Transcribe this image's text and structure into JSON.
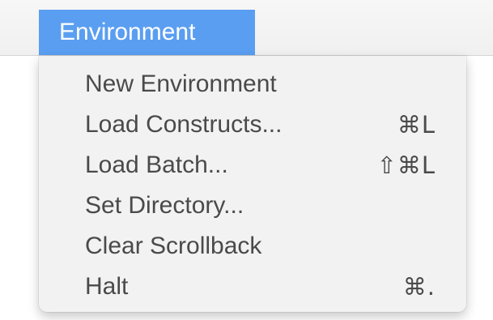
{
  "menubar": {
    "active_menu": "Environment"
  },
  "menu": {
    "items": [
      {
        "label": "New Environment",
        "shortcut": ""
      },
      {
        "label": "Load Constructs...",
        "shortcut": "⌘L"
      },
      {
        "label": "Load Batch...",
        "shortcut": "⇧⌘L"
      },
      {
        "label": "Set Directory...",
        "shortcut": ""
      },
      {
        "label": "Clear Scrollback",
        "shortcut": ""
      },
      {
        "label": "Halt",
        "shortcut": "⌘."
      }
    ]
  },
  "colors": {
    "menu_highlight": "#5a9ef1",
    "menu_background": "#f2f2f2",
    "text": "#4a4a4a"
  }
}
